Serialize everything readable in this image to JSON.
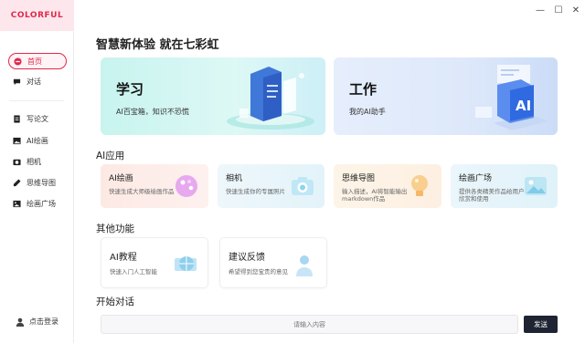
{
  "app": {
    "logo": "COLORFUL"
  },
  "window_controls": {
    "minimize": "—",
    "maximize": "☐",
    "close": "✕"
  },
  "sidebar": {
    "items": [
      {
        "label": "首页",
        "icon": "home-icon",
        "active": true
      },
      {
        "label": "对话",
        "icon": "chat-icon",
        "active": false
      },
      {
        "label": "写论文",
        "icon": "document-icon",
        "active": false
      },
      {
        "label": "AI绘画",
        "icon": "image-icon",
        "active": false
      },
      {
        "label": "相机",
        "icon": "camera-icon",
        "active": false
      },
      {
        "label": "思维导图",
        "icon": "pen-icon",
        "active": false
      },
      {
        "label": "绘画广场",
        "icon": "gallery-icon",
        "active": false
      }
    ],
    "login_label": "点击登录"
  },
  "main": {
    "title": "智慧新体验 就在七彩虹",
    "hero": [
      {
        "title": "学习",
        "subtitle": "AI百宝箱，知识不恐慌"
      },
      {
        "title": "工作",
        "subtitle": "我的AI助手"
      }
    ],
    "ai_apps_heading": "AI应用",
    "ai_apps": [
      {
        "title": "AI绘画",
        "subtitle": "快速生成大师级绘画作品"
      },
      {
        "title": "相机",
        "subtitle": "快速生成你的专属照片"
      },
      {
        "title": "思维导图",
        "subtitle": "输入描述，AI将智能输出markdown作品"
      },
      {
        "title": "绘画广场",
        "subtitle": "提供各类精美作品给用户欣赏和使用"
      }
    ],
    "other_heading": "其他功能",
    "other": [
      {
        "title": "AI教程",
        "subtitle": "快速入门人工智能"
      },
      {
        "title": "建议反馈",
        "subtitle": "希望得到您宝贵的意见"
      }
    ],
    "chat_heading": "开始对话",
    "chat_placeholder": "请输入内容",
    "send_label": "发送"
  },
  "colors": {
    "accent": "#e0284a",
    "send_button": "#1f2433"
  }
}
